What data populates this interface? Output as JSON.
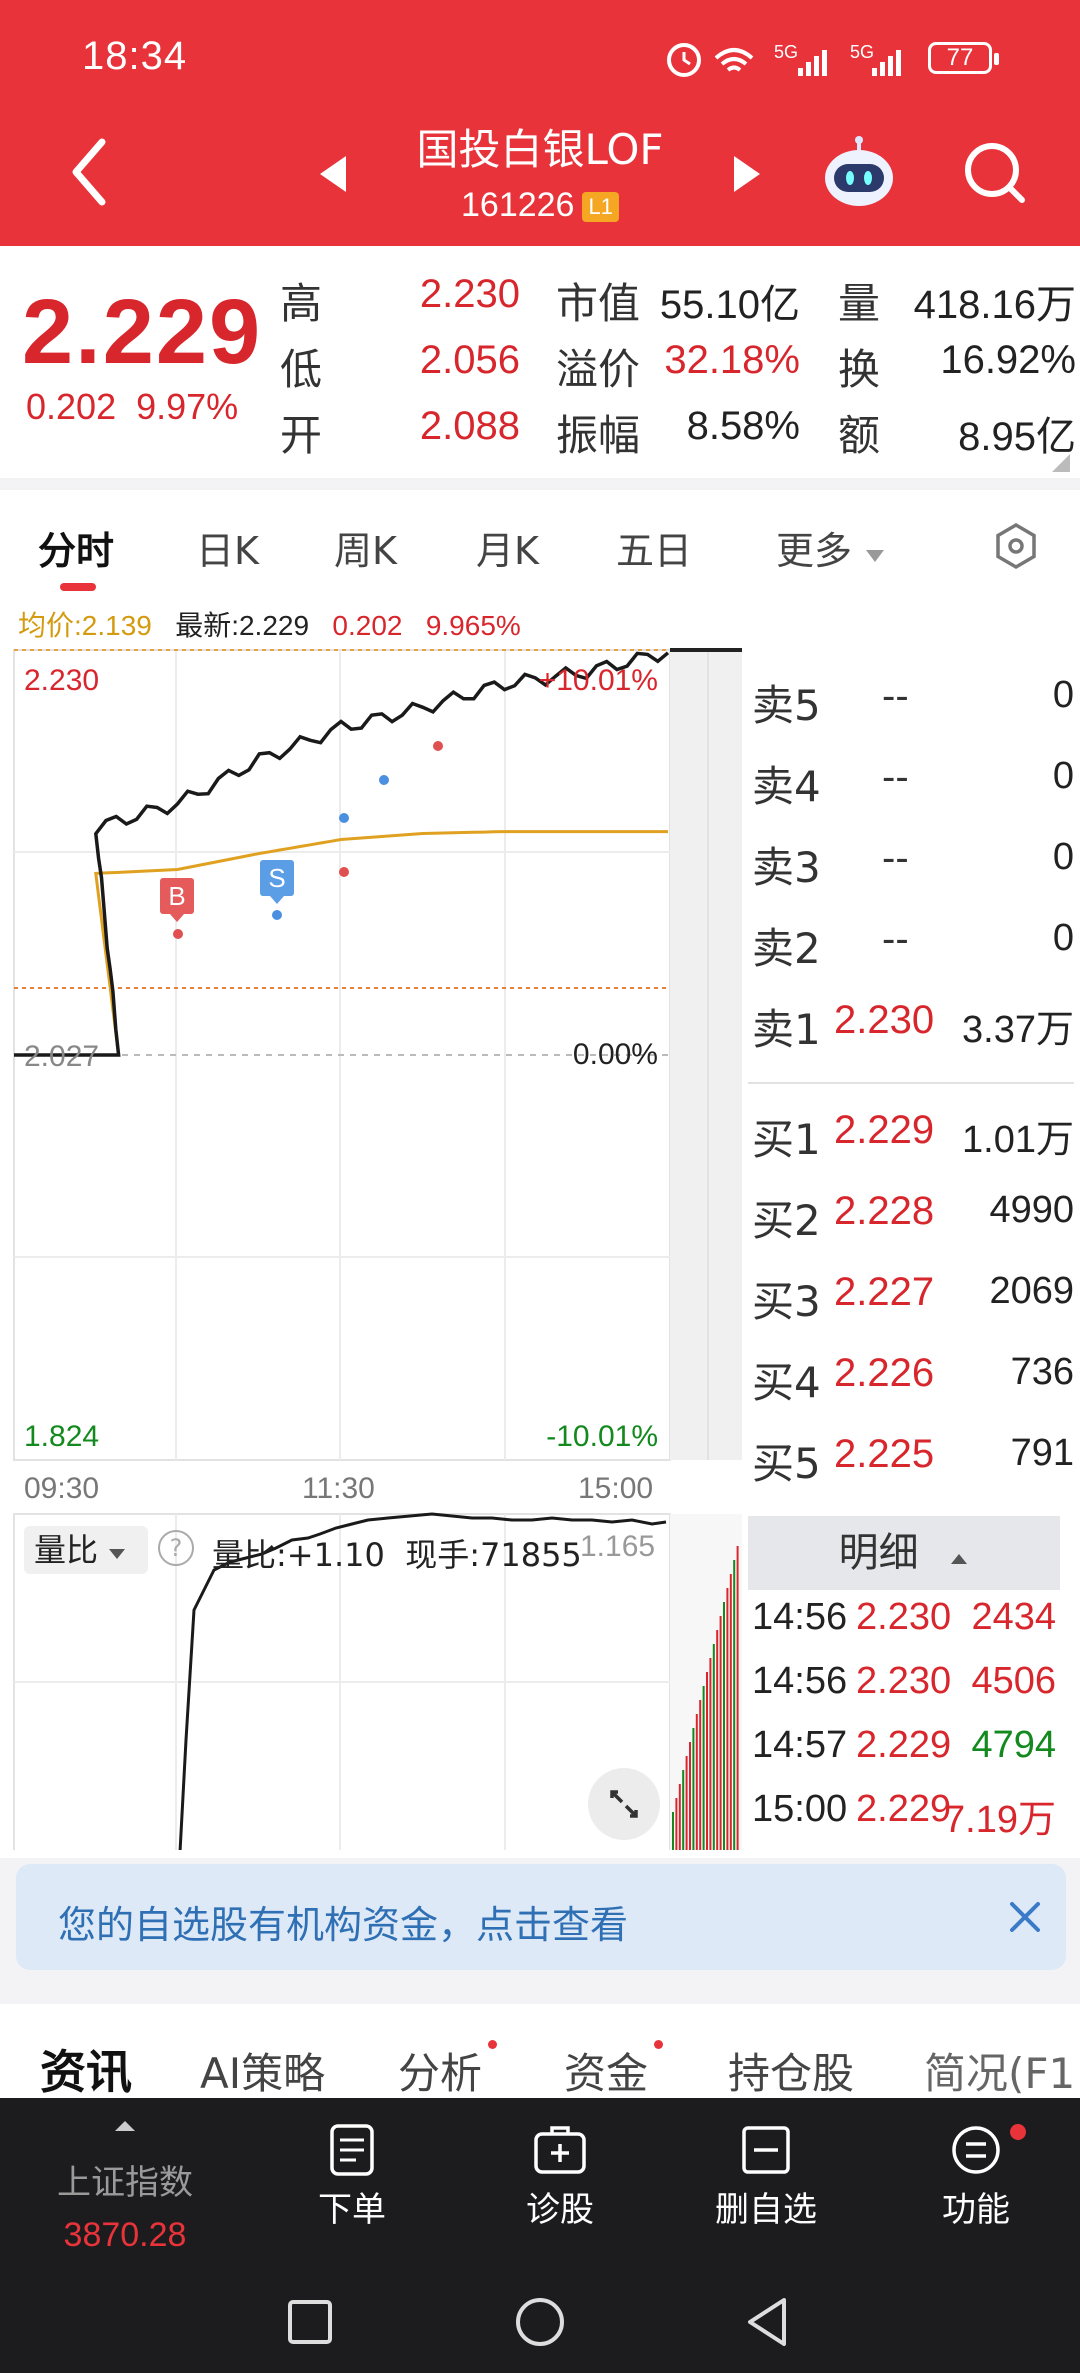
{
  "status": {
    "time": "18:34",
    "signal": "5G 5G",
    "battery": "77"
  },
  "header": {
    "name": "国投白银LOF",
    "code": "161226",
    "level": "L1"
  },
  "quote": {
    "price": "2.229",
    "change": "0.202",
    "change_pct": "9.97%",
    "rows": [
      {
        "l1": "高",
        "v1": "2.230",
        "l2": "市值",
        "v2": "55.10亿",
        "l3": "量",
        "v3": "418.16万"
      },
      {
        "l1": "低",
        "v1": "2.056",
        "l2": "溢价",
        "v2": "32.18%",
        "l3": "换",
        "v3": "16.92%"
      },
      {
        "l1": "开",
        "v1": "2.088",
        "l2": "振幅",
        "v2": "8.58%",
        "l3": "额",
        "v3": "8.95亿"
      }
    ]
  },
  "tabs": [
    "分时",
    "日K",
    "周K",
    "月K",
    "五日",
    "更多"
  ],
  "indicator": {
    "avg_label": "均价:2.139",
    "latest_label": "最新:2.229",
    "chg": "0.202",
    "pct": "9.965%"
  },
  "chart": {
    "y_top": "2.230",
    "y_mid": "2.027",
    "y_bot": "1.824",
    "pct_top": "+10.01%",
    "pct_mid": "0.00%",
    "pct_bot": "-10.01%",
    "x_ticks": [
      "09:30",
      "11:30",
      "15:00"
    ],
    "marker_b": "B",
    "marker_s": "S"
  },
  "chart_data": {
    "type": "line",
    "x": [
      "09:30",
      "10:00",
      "10:30",
      "11:00",
      "11:30",
      "13:30",
      "14:00",
      "14:30",
      "15:00"
    ],
    "series": [
      {
        "values": [
          2.027,
          2.141,
          2.153,
          2.175,
          2.191,
          2.201,
          2.213,
          2.219,
          2.229
        ]
      },
      {
        "values": [
          2.027,
          2.118,
          2.12,
          2.128,
          2.135,
          2.138,
          2.139,
          2.139,
          2.139
        ]
      }
    ],
    "ylim": [
      1.824,
      2.23
    ]
  },
  "volume_panel": {
    "selector": "量比",
    "ratio": "量比:+1.10",
    "hand": "现手:71855",
    "axis_val": "1.165"
  },
  "order_book": {
    "sell": [
      {
        "label": "卖5",
        "price": "--",
        "vol": "0"
      },
      {
        "label": "卖4",
        "price": "--",
        "vol": "0"
      },
      {
        "label": "卖3",
        "price": "--",
        "vol": "0"
      },
      {
        "label": "卖2",
        "price": "--",
        "vol": "0"
      },
      {
        "label": "卖1",
        "price": "2.230",
        "vol": "3.37万"
      }
    ],
    "buy": [
      {
        "label": "买1",
        "price": "2.229",
        "vol": "1.01万"
      },
      {
        "label": "买2",
        "price": "2.228",
        "vol": "4990"
      },
      {
        "label": "买3",
        "price": "2.227",
        "vol": "2069"
      },
      {
        "label": "买4",
        "price": "2.226",
        "vol": "736"
      },
      {
        "label": "买5",
        "price": "2.225",
        "vol": "791"
      }
    ]
  },
  "detail": {
    "title": "明细",
    "rows": [
      {
        "time": "14:56",
        "price": "2.230",
        "vol": "2434",
        "dir": "up"
      },
      {
        "time": "14:56",
        "price": "2.230",
        "vol": "4506",
        "dir": "up"
      },
      {
        "time": "14:57",
        "price": "2.229",
        "vol": "4794",
        "dir": "down"
      },
      {
        "time": "15:00",
        "price": "2.229",
        "vol": "7.19万",
        "dir": "up"
      }
    ]
  },
  "notice": {
    "text": "您的自选股有机构资金，点击查看"
  },
  "info_tabs": [
    "资讯",
    "AI策略",
    "分析",
    "资金",
    "持仓股",
    "简况(F1"
  ],
  "bottom": {
    "index_name": "上证指数",
    "index_value": "3870.28",
    "buttons": [
      {
        "label": "下单",
        "icon": "order-icon"
      },
      {
        "label": "诊股",
        "icon": "diagnose-icon"
      },
      {
        "label": "删自选",
        "icon": "remove-watchlist-icon"
      },
      {
        "label": "功能",
        "icon": "menu-icon"
      }
    ]
  },
  "colors": {
    "header_red": "#e8333a",
    "price_red": "#d8262d",
    "down_green": "#13891e",
    "avg_line": "#e0a020",
    "price_line": "#1a1a1a"
  }
}
